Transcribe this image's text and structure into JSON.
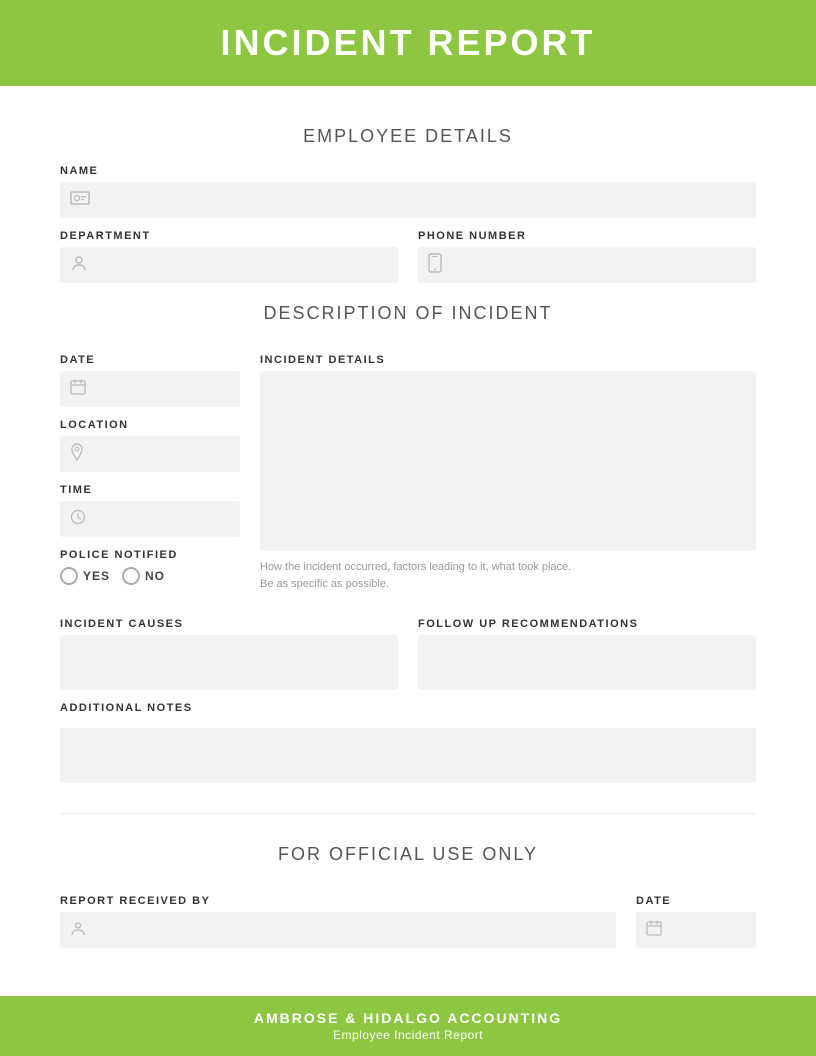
{
  "header": {
    "title": "INCIDENT REPORT"
  },
  "employee_section": {
    "title": "EMPLOYEE DETAILS",
    "name_label": "NAME",
    "name_icon": "👤",
    "department_label": "DEPARTMENT",
    "department_icon": "👥",
    "phone_label": "PHONE NUMBER",
    "phone_icon": "📱"
  },
  "incident_section": {
    "title": "DESCRIPTION OF INCIDENT",
    "date_label": "DATE",
    "date_icon": "📅",
    "location_label": "LOCATION",
    "location_icon": "📍",
    "time_label": "TIME",
    "time_icon": "🕐",
    "police_label": "POLICE NOTIFIED",
    "yes_label": "YES",
    "no_label": "NO",
    "incident_details_label": "INCIDENT DETAILS",
    "incident_hint_line1": "How the incident occurred, factors leading to it, what took place.",
    "incident_hint_line2": "Be as specific as possible.",
    "incident_causes_label": "INCIDENT CAUSES",
    "follow_up_label": "FOLLOW UP RECOMMENDATIONS",
    "additional_notes_label": "ADDITIONAL NOTES"
  },
  "official_section": {
    "title": "FOR OFFICIAL USE ONLY",
    "report_received_label": "REPORT RECEIVED BY",
    "report_received_icon": "👤",
    "date_label": "DATE",
    "date_icon": "📅"
  },
  "footer": {
    "company_name": "AMBROSE & HIDALGO ACCOUNTING",
    "subtitle": "Employee Incident Report"
  }
}
